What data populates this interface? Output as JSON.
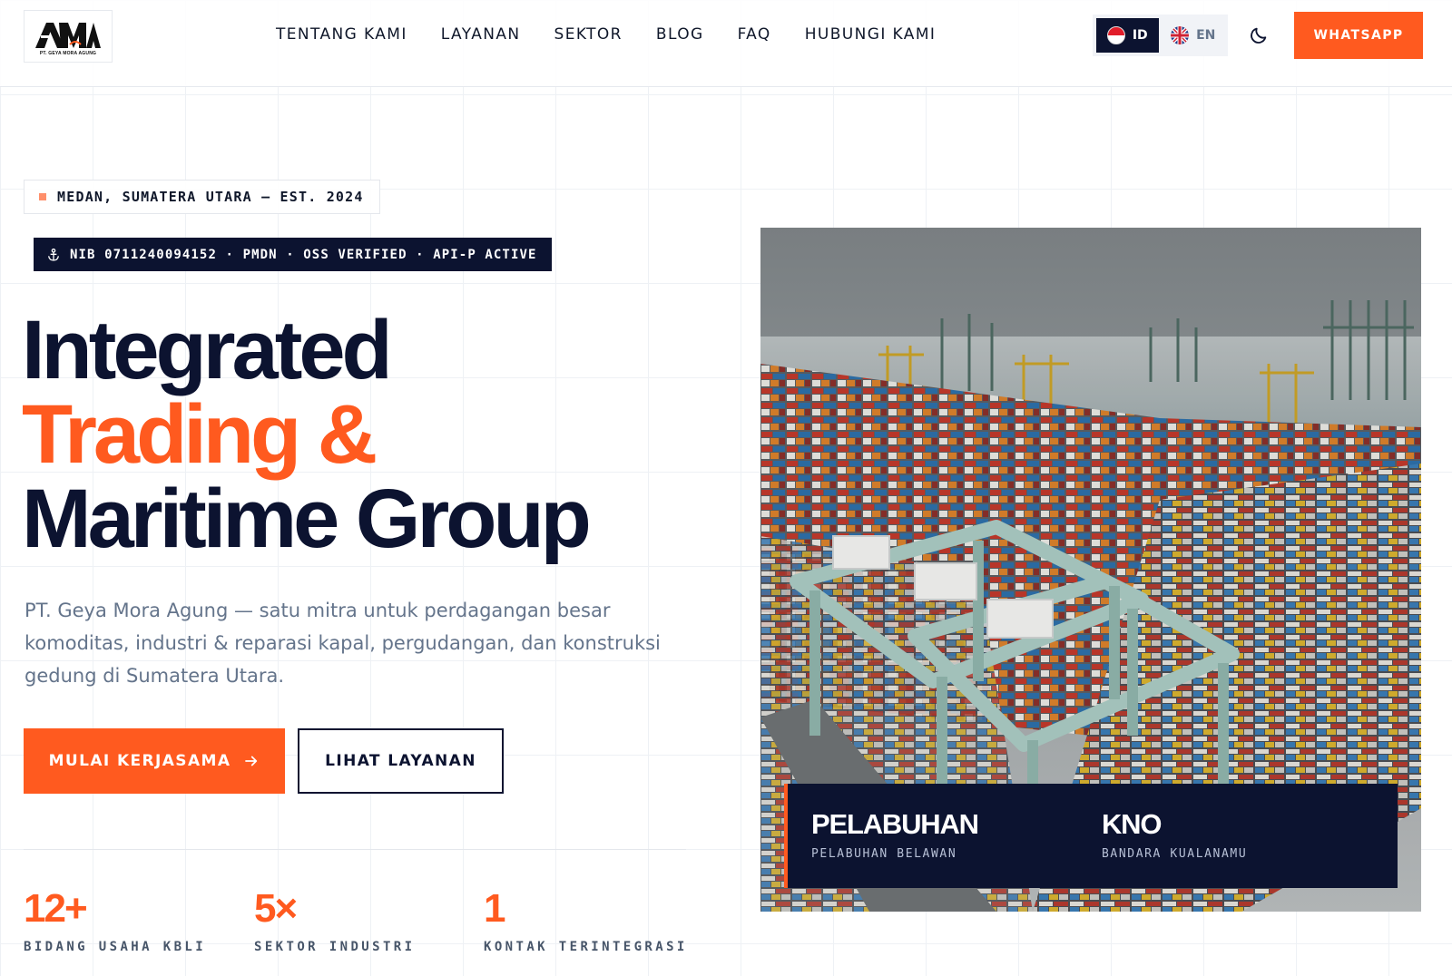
{
  "header": {
    "logo_text": "GMA",
    "logo_caption": "PT. GEYA MORA AGUNG",
    "nav": [
      {
        "label": "TENTANG KAMI"
      },
      {
        "label": "LAYANAN"
      },
      {
        "label": "SEKTOR"
      },
      {
        "label": "BLOG"
      },
      {
        "label": "FAQ"
      },
      {
        "label": "HUBUNGI KAMI"
      }
    ],
    "languages": [
      {
        "code": "ID",
        "active": true
      },
      {
        "code": "EN",
        "active": false
      }
    ],
    "theme_icon": "moon-icon",
    "cta_label": "WHATSAPP"
  },
  "hero": {
    "location_badge": "MEDAN, SUMATERA UTARA — EST. 2024",
    "registration_badge": "NIB 0711240094152 · PMDN · OSS VERIFIED · API-P ACTIVE",
    "registration_icon": "anchor-icon",
    "headline": {
      "line1": "Integrated",
      "line2": "Trading &",
      "line3": "Maritime Group"
    },
    "description": "PT. Geya Mora Agung — satu mitra untuk perdagangan besar komoditas, industri & reparasi kapal, pergudangan, dan konstruksi gedung di Sumatera Utara.",
    "primary_button": "MULAI KERJASAMA",
    "secondary_button": "LIHAT LAYANAN",
    "stats": [
      {
        "value": "12+",
        "label": "BIDANG USAHA KBLI"
      },
      {
        "value": "5×",
        "label": "SEKTOR INDUSTRI"
      },
      {
        "value": "1",
        "label": "KONTAK TERINTEGRASI"
      }
    ]
  },
  "image_card": {
    "items": [
      {
        "title": "PELABUHAN",
        "subtitle": "PELABUHAN BELAWAN"
      },
      {
        "title": "KNO",
        "subtitle": "BANDARA KUALANAMU"
      }
    ]
  },
  "colors": {
    "accent": "#ff5a1f",
    "navy": "#0c1330",
    "muted_text": "#64748b"
  }
}
